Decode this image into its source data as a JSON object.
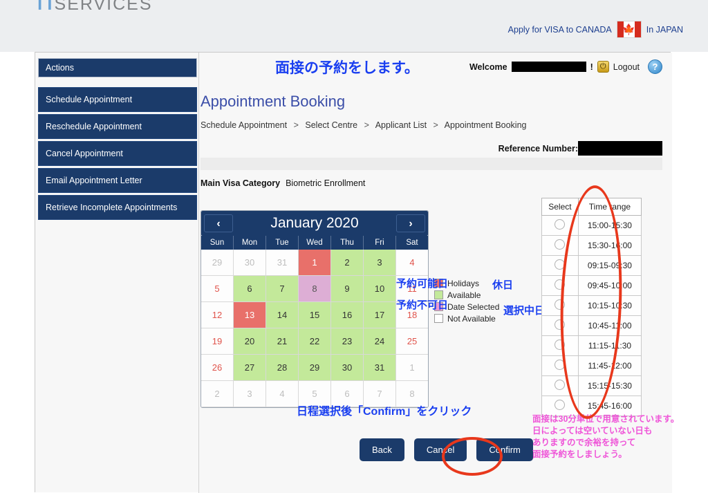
{
  "brand": {
    "logo_tt": "TT",
    "logo_rest": "SERVICES",
    "apply_text": "Apply for VISA to CANADA",
    "in_japan": "In JAPAN",
    "flag_icon": "canada-flag-icon"
  },
  "sidebar": {
    "header": "Actions",
    "items": [
      {
        "label": "Schedule Appointment"
      },
      {
        "label": "Reschedule Appointment"
      },
      {
        "label": "Cancel Appointment"
      },
      {
        "label": "Email Appointment Letter"
      },
      {
        "label": "Retrieve Incomplete Appointments"
      }
    ]
  },
  "header": {
    "jp_title": "面接の予約をします。",
    "welcome_label": "Welcome",
    "welcome_name": "",
    "exclaim": "!",
    "logout_label": "Logout",
    "help_glyph": "?",
    "power_glyph": "⏻"
  },
  "main": {
    "page_title": "Appointment Booking",
    "breadcrumb": [
      "Schedule Appointment",
      "Select Centre",
      "Applicant List",
      "Appointment Booking"
    ],
    "breadcrumb_sep": ">",
    "reference_label": "Reference Number:",
    "reference_value": "",
    "visa_category_label": "Main Visa Category",
    "visa_category_value": "Biometric Enrollment"
  },
  "calendar": {
    "prev_glyph": "‹",
    "next_glyph": "›",
    "month_title": "January 2020",
    "dow": [
      "Sun",
      "Mon",
      "Tue",
      "Wed",
      "Thu",
      "Fri",
      "Sat"
    ],
    "weeks": [
      [
        {
          "n": "29",
          "state": "out"
        },
        {
          "n": "30",
          "state": "out"
        },
        {
          "n": "31",
          "state": "out"
        },
        {
          "n": "1",
          "state": "holiday"
        },
        {
          "n": "2",
          "state": "avail"
        },
        {
          "n": "3",
          "state": "avail"
        },
        {
          "n": "4",
          "state": "na wknd"
        }
      ],
      [
        {
          "n": "5",
          "state": "na wknd"
        },
        {
          "n": "6",
          "state": "avail"
        },
        {
          "n": "7",
          "state": "avail"
        },
        {
          "n": "8",
          "state": "selected"
        },
        {
          "n": "9",
          "state": "avail"
        },
        {
          "n": "10",
          "state": "avail"
        },
        {
          "n": "11",
          "state": "na wknd"
        }
      ],
      [
        {
          "n": "12",
          "state": "na wknd"
        },
        {
          "n": "13",
          "state": "holiday"
        },
        {
          "n": "14",
          "state": "avail"
        },
        {
          "n": "15",
          "state": "avail"
        },
        {
          "n": "16",
          "state": "avail"
        },
        {
          "n": "17",
          "state": "avail"
        },
        {
          "n": "18",
          "state": "na wknd"
        }
      ],
      [
        {
          "n": "19",
          "state": "na wknd"
        },
        {
          "n": "20",
          "state": "avail"
        },
        {
          "n": "21",
          "state": "avail"
        },
        {
          "n": "22",
          "state": "avail"
        },
        {
          "n": "23",
          "state": "avail"
        },
        {
          "n": "24",
          "state": "avail"
        },
        {
          "n": "25",
          "state": "na wknd"
        }
      ],
      [
        {
          "n": "26",
          "state": "na wknd"
        },
        {
          "n": "27",
          "state": "avail"
        },
        {
          "n": "28",
          "state": "avail"
        },
        {
          "n": "29",
          "state": "avail"
        },
        {
          "n": "30",
          "state": "avail"
        },
        {
          "n": "31",
          "state": "avail"
        },
        {
          "n": "1",
          "state": "out"
        }
      ],
      [
        {
          "n": "2",
          "state": "out"
        },
        {
          "n": "3",
          "state": "out"
        },
        {
          "n": "4",
          "state": "out"
        },
        {
          "n": "5",
          "state": "out"
        },
        {
          "n": "6",
          "state": "out"
        },
        {
          "n": "7",
          "state": "out"
        },
        {
          "n": "8",
          "state": "out"
        }
      ]
    ]
  },
  "legend": [
    {
      "label": "Holidays",
      "color": "#ef7069"
    },
    {
      "label": "Available",
      "color": "#c3e99a"
    },
    {
      "label": "Date Selected",
      "color": "#eb9ad1"
    },
    {
      "label": "Not Available",
      "color": "#ffffff"
    }
  ],
  "timetable": {
    "headers": [
      "Select",
      "Time range"
    ],
    "rows": [
      "15:00-15:30",
      "15:30-16:00",
      "09:15-09:30",
      "09:45-10:00",
      "10:15-10:30",
      "10:45-11:00",
      "11:15-11:30",
      "11:45-12:00",
      "15:15-15:30",
      "15:45-16:00"
    ]
  },
  "buttons": {
    "back": "Back",
    "cancel": "Cancel",
    "confirm": "Confirm"
  },
  "annotations": {
    "available_days": "予約可能日",
    "not_available_days": "予約不可日",
    "holidays_jp": "休日",
    "selected_date_jp": "選択中日付",
    "confirm_hint": "日程選択後「Confirm」をクリック",
    "pink_note_lines": [
      "面接は30分単位で用意されています。",
      "日によっては空いていない日も",
      "ありますので余裕を持って",
      "面接予約をしましょう。"
    ]
  },
  "colors": {
    "navy": "#1b3b6a",
    "annotation_blue": "#1a3ff0",
    "annotation_pink": "#ef55d8",
    "ellipse_red": "#e8381c",
    "available_green": "#c3e99a",
    "holiday_red": "#e8706a",
    "selected_pink": "#ddaed5"
  }
}
